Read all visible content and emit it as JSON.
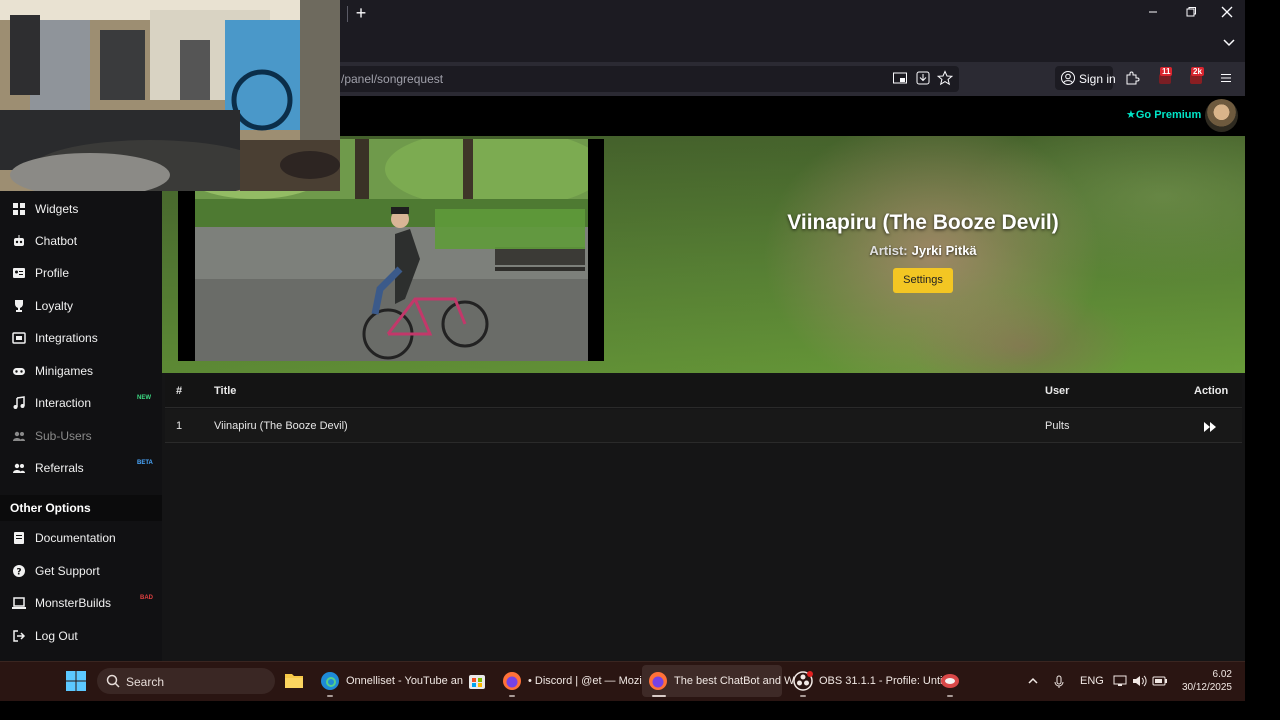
{
  "browser": {
    "url": "/panel/songrequest",
    "signin_label": "Sign in",
    "new_tab_glyph": "+",
    "ext_badge_1": "11",
    "ext_badge_2": "2k"
  },
  "site": {
    "premium_label": "Go Premium"
  },
  "sidebar": {
    "items": [
      {
        "label": "Widgets",
        "icon": "widgets-icon",
        "tag": ""
      },
      {
        "label": "Chatbot",
        "icon": "robot-icon",
        "tag": ""
      },
      {
        "label": "Profile",
        "icon": "id-card-icon",
        "tag": ""
      },
      {
        "label": "Loyalty",
        "icon": "trophy-icon",
        "tag": ""
      },
      {
        "label": "Integrations",
        "icon": "plug-icon",
        "tag": ""
      },
      {
        "label": "Minigames",
        "icon": "gamepad-icon",
        "tag": ""
      },
      {
        "label": "Interaction",
        "icon": "music-note-icon",
        "tag": "NEW"
      },
      {
        "label": "Sub-Users",
        "icon": "users-icon",
        "tag": ""
      },
      {
        "label": "Referrals",
        "icon": "user-group-icon",
        "tag": "BETA"
      }
    ],
    "other_heading": "Other Options",
    "other_items": [
      {
        "label": "Documentation",
        "icon": "scroll-icon",
        "tag": ""
      },
      {
        "label": "Get Support",
        "icon": "question-icon",
        "tag": ""
      },
      {
        "label": "MonsterBuilds",
        "icon": "laptop-icon",
        "tag": "BAD"
      },
      {
        "label": "Log Out",
        "icon": "logout-icon",
        "tag": ""
      }
    ]
  },
  "now_playing": {
    "title": "Viinapiru (The Booze Devil)",
    "artist_label": "Artist:",
    "artist": "Jyrki Pitkä",
    "settings_label": "Settings"
  },
  "queue": {
    "headers": {
      "num": "#",
      "title": "Title",
      "user": "User",
      "action": "Action"
    },
    "rows": [
      {
        "num": "1",
        "title": "Viinapiru (The Booze Devil)",
        "user": "Pults"
      }
    ]
  },
  "taskbar": {
    "search_label": "Search",
    "apps": [
      "Onnelliset - YouTube an",
      "• Discord | @et — Mozil",
      "The best ChatBot and W",
      "OBS 31.1.1 - Profile: Unti"
    ],
    "lang": "ENG",
    "time": "6.02",
    "date": "30/12/2025"
  },
  "colors": {
    "accent_premium": "#00e5c7",
    "settings_button": "#f3c623",
    "tag_new": "#3ddc84",
    "tag_beta": "#4aa8ff"
  }
}
